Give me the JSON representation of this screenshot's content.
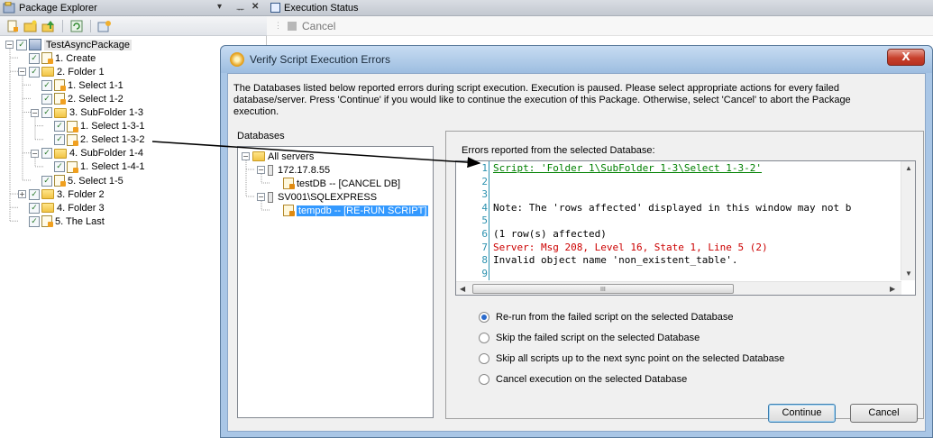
{
  "package_explorer": {
    "title": "Package Explorer",
    "pin_glyph": "▾",
    "dock_glyph": "ᅲ",
    "close_glyph": "✕",
    "toolbar_icons": [
      "new-script-icon",
      "new-folder-icon",
      "move-up-icon",
      "refresh-icon",
      "properties-icon"
    ],
    "tree": [
      {
        "label": "TestAsyncPackage",
        "depth": 0,
        "kind": "package",
        "expander": "⊟"
      },
      {
        "label": "1. Create",
        "depth": 1,
        "kind": "script"
      },
      {
        "label": "2. Folder 1",
        "depth": 1,
        "kind": "folder",
        "expander": "⊟"
      },
      {
        "label": "1. Select 1-1",
        "depth": 2,
        "kind": "script"
      },
      {
        "label": "2. Select 1-2",
        "depth": 2,
        "kind": "script"
      },
      {
        "label": "3. SubFolder 1-3",
        "depth": 2,
        "kind": "folder",
        "expander": "⊟"
      },
      {
        "label": "1. Select 1-3-1",
        "depth": 3,
        "kind": "script"
      },
      {
        "label": "2. Select 1-3-2",
        "depth": 3,
        "kind": "script"
      },
      {
        "label": "4. SubFolder 1-4",
        "depth": 2,
        "kind": "folder",
        "expander": "⊟"
      },
      {
        "label": "1. Select 1-4-1",
        "depth": 3,
        "kind": "script"
      },
      {
        "label": "5. Select 1-5",
        "depth": 2,
        "kind": "script"
      },
      {
        "label": "3. Folder 2",
        "depth": 1,
        "kind": "folder",
        "expander": "⊞"
      },
      {
        "label": "4. Folder 3",
        "depth": 1,
        "kind": "folder"
      },
      {
        "label": "5. The Last",
        "depth": 1,
        "kind": "script"
      }
    ]
  },
  "execution_status": {
    "title": "Execution Status",
    "cancel_label": "Cancel"
  },
  "dialog": {
    "title": "Verify Script Execution Errors",
    "close_glyph": "X",
    "message_line1": "The Databases listed below reported errors during script execution. Execution is paused. Please select appropriate actions for every failed",
    "message_line2": "database/server. Press 'Continue' if you would like to continue the execution of this Package. Otherwise, select 'Cancel' to abort the Package",
    "message_line3": "execution.",
    "databases_label": "Databases",
    "databases": [
      {
        "label": "All servers",
        "depth": 0,
        "kind": "folder",
        "expander": "⊟"
      },
      {
        "label": "172.17.8.55",
        "depth": 1,
        "kind": "server",
        "expander": "⊟"
      },
      {
        "label": "testDB -- [CANCEL DB]",
        "depth": 2,
        "kind": "db"
      },
      {
        "label": "SV001\\SQLEXPRESS",
        "depth": 1,
        "kind": "server",
        "expander": "⊟"
      },
      {
        "label": "tempdb -- [RE-RUN SCRIPT]",
        "depth": 2,
        "kind": "db",
        "selected": true
      }
    ],
    "errors_label": "Errors reported from the selected Database:",
    "code_lines": [
      {
        "num": "1",
        "text": "Script: 'Folder 1\\SubFolder 1-3\\Select 1-3-2'",
        "style": "script"
      },
      {
        "num": "2",
        "text": "",
        "style": "normal"
      },
      {
        "num": "3",
        "text": "",
        "style": "normal"
      },
      {
        "num": "4",
        "text": "Note: The 'rows affected' displayed in this window may not b",
        "style": "normal"
      },
      {
        "num": "5",
        "text": "",
        "style": "normal"
      },
      {
        "num": "6",
        "text": "(1 row(s) affected)",
        "style": "normal"
      },
      {
        "num": "7",
        "text": "Server: Msg 208, Level 16, State 1, Line 5 (2)",
        "style": "error"
      },
      {
        "num": "8",
        "text": "Invalid object name 'non_existent_table'.",
        "style": "normal"
      },
      {
        "num": "9",
        "text": "",
        "style": "normal"
      }
    ],
    "scroll_grip": "III",
    "options": [
      {
        "label": "Re-run from the failed script on the selected Database",
        "selected": true
      },
      {
        "label": "Skip the failed script on the selected Database",
        "selected": false
      },
      {
        "label": "Skip all scripts up to the next sync point on the selected Database",
        "selected": false
      },
      {
        "label": "Cancel execution on the selected Database",
        "selected": false
      }
    ],
    "continue_label": "Continue",
    "cancel_label": "Cancel"
  },
  "colors": {
    "selection": "#3399ff",
    "script_header": "#008000",
    "error_text": "#cc0000",
    "line_number": "#2b91af",
    "arrow": "#000000"
  }
}
